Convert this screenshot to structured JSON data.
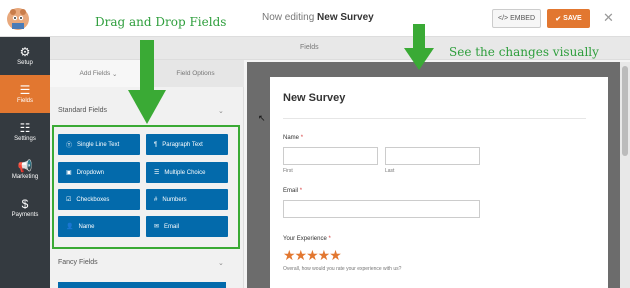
{
  "header": {
    "editing_prefix": "Now editing",
    "form_name": "New Survey",
    "embed_label": "EMBED",
    "save_label": "SAVE",
    "close_symbol": "✕"
  },
  "sidebar": {
    "items": [
      {
        "label": "Setup",
        "icon": "gear-icon"
      },
      {
        "label": "Fields",
        "icon": "list-icon"
      },
      {
        "label": "Settings",
        "icon": "sliders-icon"
      },
      {
        "label": "Marketing",
        "icon": "megaphone-icon"
      },
      {
        "label": "Payments",
        "icon": "dollar-icon"
      }
    ]
  },
  "fields_header": "Fields",
  "panel": {
    "tab_add": "Add Fields",
    "tab_options": "Field Options",
    "standard_title": "Standard Fields",
    "fancy_title": "Fancy Fields",
    "fields": [
      {
        "label": "Single Line Text",
        "icon": "text-icon"
      },
      {
        "label": "Paragraph Text",
        "icon": "paragraph-icon"
      },
      {
        "label": "Dropdown",
        "icon": "dropdown-icon"
      },
      {
        "label": "Multiple Choice",
        "icon": "list-icon"
      },
      {
        "label": "Checkboxes",
        "icon": "checkbox-icon"
      },
      {
        "label": "Numbers",
        "icon": "hash-icon"
      },
      {
        "label": "Name",
        "icon": "user-icon"
      },
      {
        "label": "Email",
        "icon": "envelope-icon"
      }
    ]
  },
  "preview": {
    "title": "New Survey",
    "name_label": "Name",
    "first_label": "First",
    "last_label": "Last",
    "email_label": "Email",
    "experience_label": "Your Experience",
    "rating_question": "Overall, how would you rate your experience with us?",
    "required_mark": "*",
    "stars": "★★★★★"
  },
  "annotations": {
    "drag_drop": "Drag and Drop Fields",
    "see_changes": "See the changes visually"
  },
  "colors": {
    "accent": "#e27730",
    "field_button": "#036aab",
    "annotation": "#2e9e3c",
    "sidebar": "#343a40"
  }
}
